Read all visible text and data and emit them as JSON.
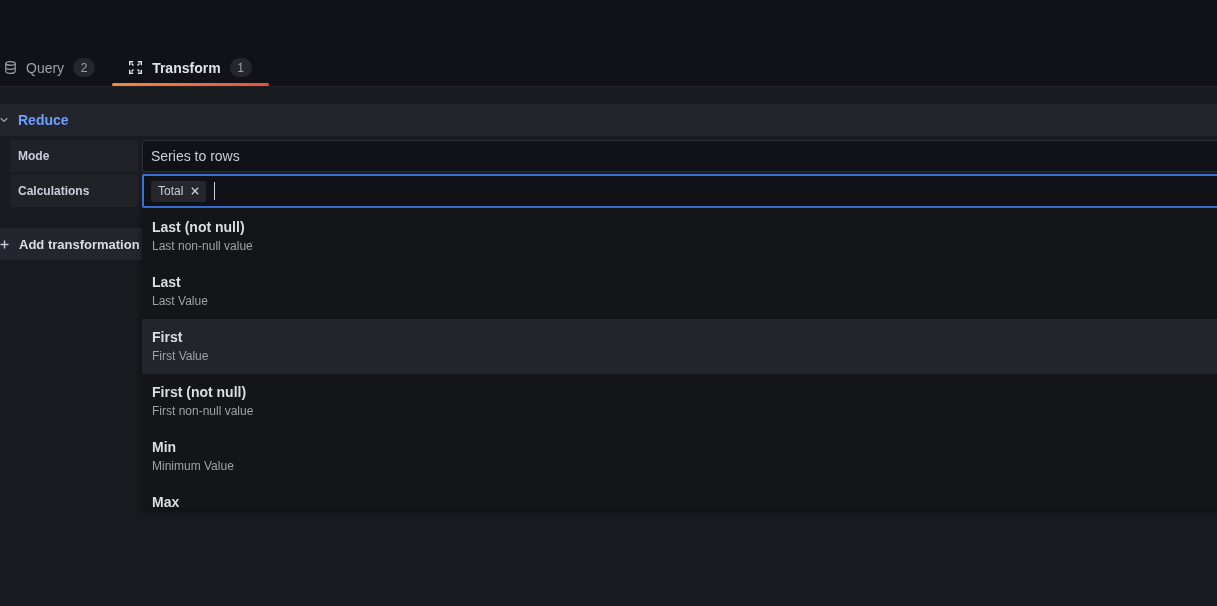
{
  "tabs": [
    {
      "label": "Query",
      "count": "2",
      "selected": false
    },
    {
      "label": "Transform",
      "count": "1",
      "selected": true
    }
  ],
  "transformation": {
    "title": "Reduce",
    "expanded": true,
    "fields": [
      {
        "kind": "select",
        "label": "Mode",
        "value": "Series to rows",
        "focused": false
      },
      {
        "kind": "multiselect",
        "label": "Calculations",
        "chips": [
          "Total"
        ],
        "focused": true,
        "options": [
          {
            "label": "Last (not null)",
            "description": "Last non-null value",
            "selected": false
          },
          {
            "label": "Last",
            "description": "Last Value",
            "selected": false
          },
          {
            "label": "First",
            "description": "First Value",
            "selected": true
          },
          {
            "label": "First (not null)",
            "description": "First non-null value",
            "selected": false
          },
          {
            "label": "Min",
            "description": "Minimum Value",
            "selected": false
          },
          {
            "label": "Max",
            "selected": false
          }
        ]
      }
    ]
  },
  "add_button": {
    "label": "Add transformation"
  }
}
